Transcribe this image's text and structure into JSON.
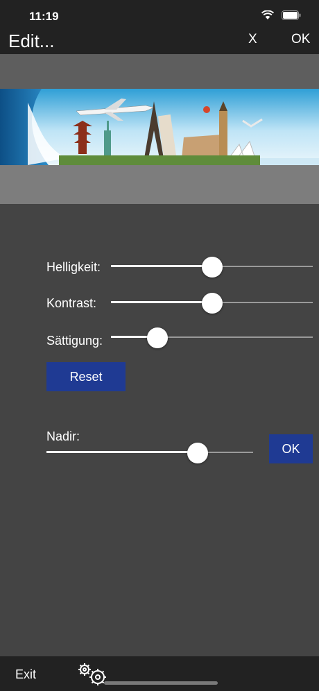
{
  "status": {
    "time": "11:19"
  },
  "nav": {
    "title": "Edit...",
    "close_label": "X",
    "ok_label": "OK"
  },
  "adjustments": {
    "brightness": {
      "label": "Helligkeit:",
      "value": 0.5
    },
    "contrast": {
      "label": "Kontrast:",
      "value": 0.5
    },
    "saturation": {
      "label": "Sättigung:",
      "value": 0.23
    },
    "reset_label": "Reset"
  },
  "nadir": {
    "label": "Nadir:",
    "value": 0.73,
    "ok_label": "OK"
  },
  "bottom": {
    "exit_label": "Exit"
  },
  "icons": [
    "wifi-icon",
    "battery-icon",
    "gears-icon"
  ],
  "colors": {
    "button": "#1f3a93",
    "background": "#444444",
    "bars": "#222222"
  }
}
